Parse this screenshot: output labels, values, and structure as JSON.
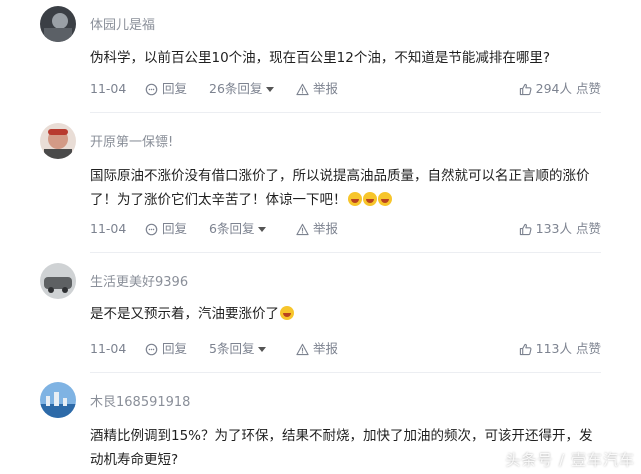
{
  "comments": [
    {
      "username": "体园儿是福",
      "content": "伪科学，以前百公里10个油，现在百公里12个油，不知道是节能减排在哪里?",
      "date": "11-04",
      "reply_label": "回复",
      "replies_label": "26条回复",
      "report_label": "举报",
      "likes_label": "294人 点赞",
      "avatar_color": "#3b3f45"
    },
    {
      "username": "开原第一保镖!",
      "content": "国际原油不涨价没有借口涨价了，所以说提高油品质量，自然就可以名正言顺的涨价了！为了涨价它们太辛苦了！体谅一下吧！",
      "emoji_count": 3,
      "date": "11-04",
      "reply_label": "回复",
      "replies_label": "6条回复",
      "report_label": "举报",
      "likes_label": "133人 点赞",
      "avatar_color": "#c97a6b"
    },
    {
      "username": "生活更美好9396",
      "content": "是不是又预示着，汽油要涨价了",
      "emoji_count": 1,
      "date": "11-04",
      "reply_label": "回复",
      "replies_label": "5条回复",
      "report_label": "举报",
      "likes_label": "113人 点赞",
      "avatar_color": "#6b6e70"
    },
    {
      "username": "木艮168591918",
      "content": "酒精比例调到15%？为了环保，结果不耐烧，加快了加油的频次，可该开还得开，发动机寿命更短?",
      "avatar_color": "#2d6aa8"
    }
  ],
  "watermark": "头条号 / 壹车汽车"
}
